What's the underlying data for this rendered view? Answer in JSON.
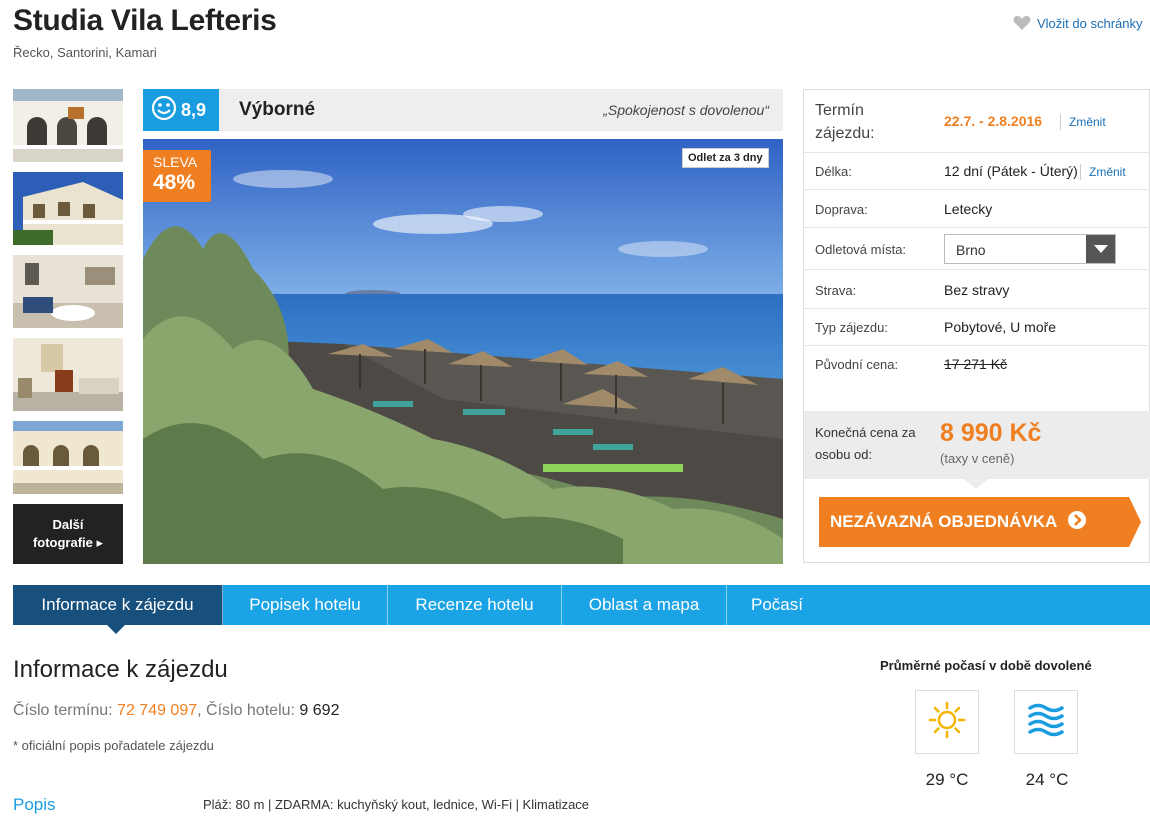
{
  "header": {
    "title": "Studia Vila Lefteris",
    "location": "Řecko, Santorini, Kamari",
    "wishlist_label": "Vložit do schránky"
  },
  "gallery": {
    "more_line1": "Další",
    "more_line2": "fotografie"
  },
  "rating": {
    "score": "8,9",
    "word": "Výborné",
    "quote": "„Spokojenost s dovolenou“"
  },
  "photo": {
    "discount_label": "SLEVA",
    "discount_value": "48%",
    "departure_badge": "Odlet za 3 dny"
  },
  "booking": {
    "term_label": "Termín zájezdu:",
    "term_value": "22.7. - 2.8.2016",
    "change_label": "Změnit",
    "length_label": "Délka:",
    "length_value": "12 dní (Pátek - Úterý)",
    "transport_label": "Doprava:",
    "transport_value": "Letecky",
    "departure_label": "Odletová místa:",
    "departure_value": "Brno",
    "board_label": "Strava:",
    "board_value": "Bez stravy",
    "type_label": "Typ zájezdu:",
    "type_value": "Pobytové, U moře",
    "orig_price_label": "Původní cena:",
    "orig_price_value": "17 271 Kč",
    "final_price_label_1": "Konečná cena za",
    "final_price_label_2": "osobu od:",
    "final_price_value": "8 990 Kč",
    "final_price_note": "(taxy v ceně)",
    "cta_label": "NEZÁVAZNÁ OBJEDNÁVKA"
  },
  "tabs": [
    {
      "label": "Informace k zájezdu",
      "active": true
    },
    {
      "label": "Popisek hotelu",
      "active": false
    },
    {
      "label": "Recenze hotelu",
      "active": false
    },
    {
      "label": "Oblast a mapa",
      "active": false
    },
    {
      "label": "Počasí",
      "active": false
    }
  ],
  "info": {
    "heading": "Informace k zájezdu",
    "term_no_label": "Číslo termínu:",
    "term_no": "72 749 097",
    "hotel_no_label": "Číslo hotelu:",
    "hotel_no": "9 692",
    "comma": ",",
    "official_note": "* oficiální popis pořadatele zájezdu",
    "popis_heading": "Popis",
    "popis_text": "Pláž: 80 m | ZDARMA: kuchyňský kout, lednice, Wi-Fi | Klimatizace"
  },
  "weather": {
    "heading": "Průměrné počasí v době dovolené",
    "air_icon": "sun-icon",
    "air_temp": "29 °C",
    "water_icon": "water-waves-icon",
    "water_temp": "24 °C"
  },
  "colors": {
    "accent_orange": "#f07f22",
    "accent_blue": "#1aa3e5",
    "tab_active": "#174f7d",
    "link_blue": "#1a6fb5"
  }
}
